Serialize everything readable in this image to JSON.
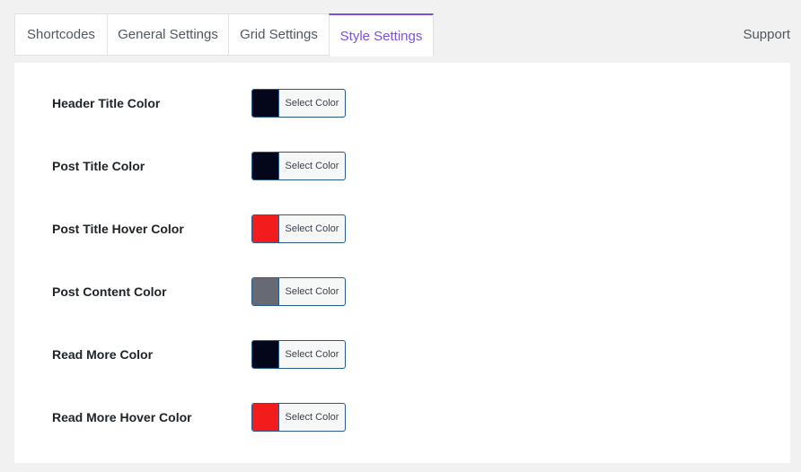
{
  "tabs": [
    {
      "label": "Shortcodes",
      "active": false
    },
    {
      "label": "General Settings",
      "active": false
    },
    {
      "label": "Grid Settings",
      "active": false
    },
    {
      "label": "Style Settings",
      "active": true
    }
  ],
  "support_label": "Support",
  "colors": {
    "accent": "#7d4fdb",
    "button_border": "#2a5a8a"
  },
  "settings": [
    {
      "label": "Header Title Color",
      "color": "#04061a",
      "button_label": "Select Color"
    },
    {
      "label": "Post Title Color",
      "color": "#04061a",
      "button_label": "Select Color"
    },
    {
      "label": "Post Title Hover Color",
      "color": "#f21c1c",
      "button_label": "Select Color"
    },
    {
      "label": "Post Content Color",
      "color": "#676a72",
      "button_label": "Select Color"
    },
    {
      "label": "Read More Color",
      "color": "#04061a",
      "button_label": "Select Color"
    },
    {
      "label": "Read More Hover Color",
      "color": "#f21c1c",
      "button_label": "Select Color"
    }
  ]
}
